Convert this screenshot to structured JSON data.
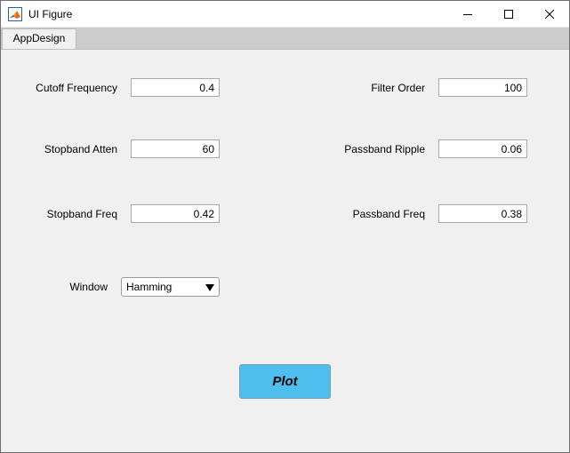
{
  "window": {
    "title": "UI Figure",
    "icon": "matlab-icon"
  },
  "tabs": [
    {
      "label": "AppDesign",
      "selected": true
    }
  ],
  "form": {
    "cutoff_frequency": {
      "label": "Cutoff Frequency",
      "value": "0.4"
    },
    "filter_order": {
      "label": "Filter Order",
      "value": "100"
    },
    "stopband_atten": {
      "label": "Stopband Atten",
      "value": "60"
    },
    "passband_ripple": {
      "label": "Passband Ripple",
      "value": "0.06"
    },
    "stopband_freq": {
      "label": "Stopband Freq",
      "value": "0.42"
    },
    "passband_freq": {
      "label": "Passband Freq",
      "value": "0.38"
    },
    "window": {
      "label": "Window",
      "value": "Hamming"
    }
  },
  "plot_button": {
    "label": "Plot",
    "color": "#4dbeee"
  },
  "colors": {
    "panel_background": "#f0f0f0",
    "tabstrip_background": "#cccccc"
  }
}
